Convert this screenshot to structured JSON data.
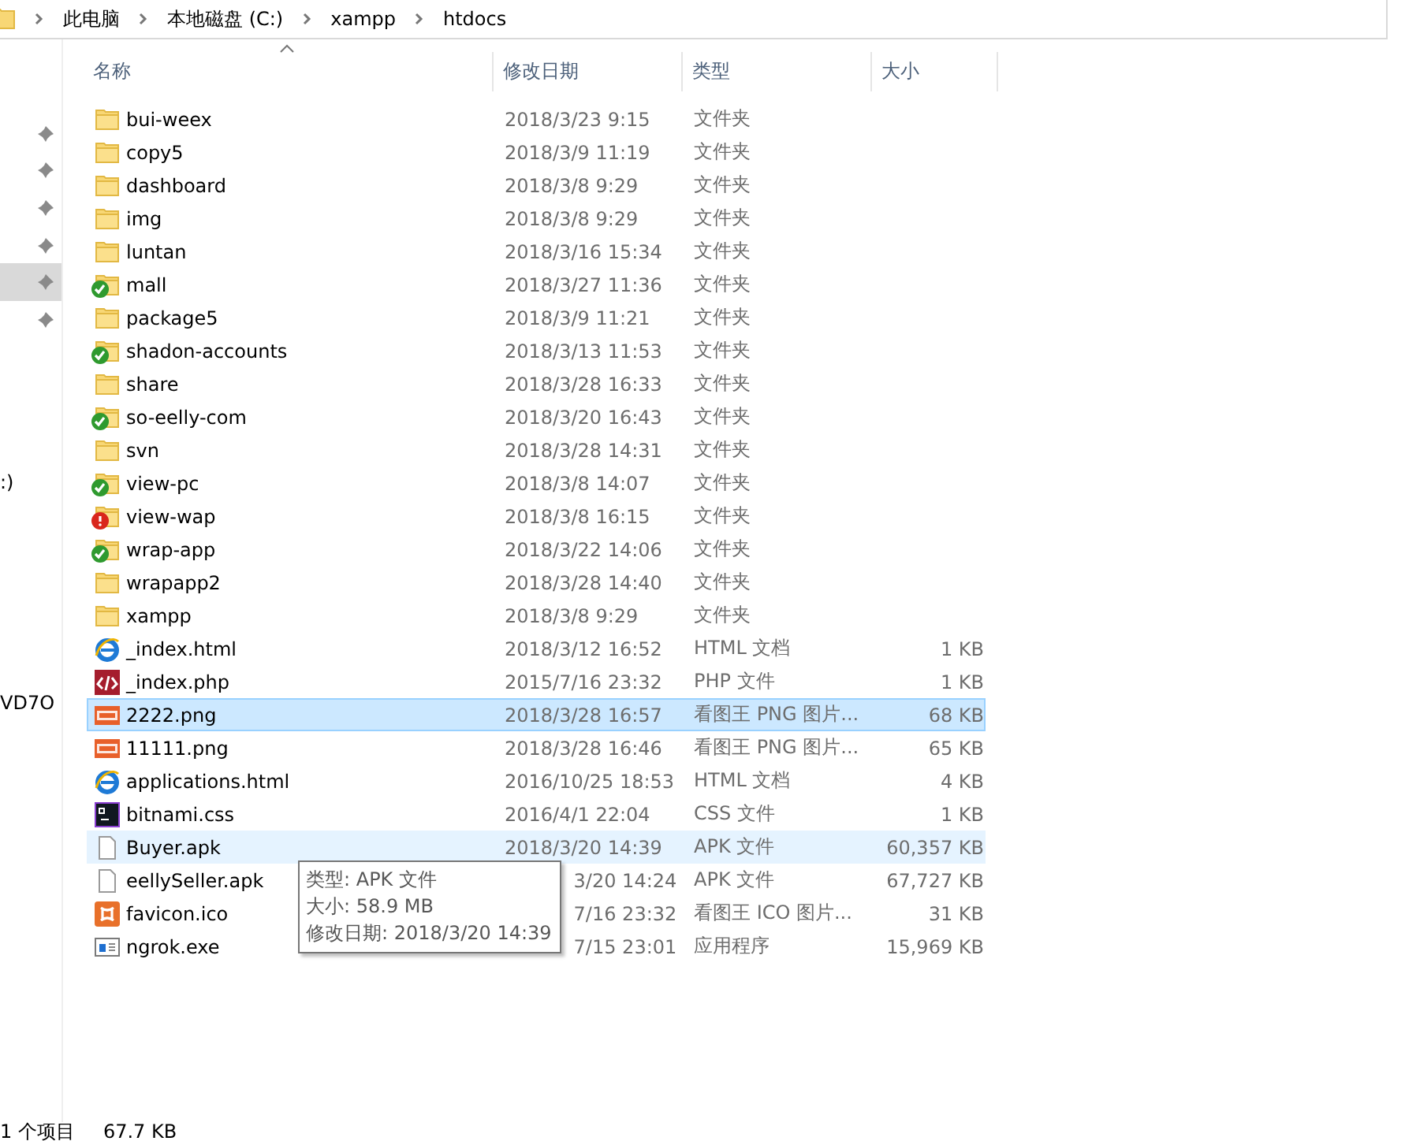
{
  "breadcrumb": [
    "此电脑",
    "本地磁盘 (C:)",
    "xampp",
    "htdocs"
  ],
  "nav_pane": {
    "pins": [
      {
        "selected": false
      },
      {
        "selected": false
      },
      {
        "selected": false
      },
      {
        "selected": false
      },
      {
        "selected": true
      },
      {
        "selected": false
      }
    ],
    "texts": [
      ":)",
      "VD7O"
    ]
  },
  "columns": [
    "名称",
    "修改日期",
    "类型",
    "大小"
  ],
  "rows": [
    {
      "name": "bui-weex",
      "date": "2018/3/23 9:15",
      "type": "文件夹",
      "kind": "folder",
      "selected": false,
      "hovered": false
    },
    {
      "name": "copy5",
      "date": "2018/3/9 11:19",
      "type": "文件夹",
      "kind": "folder",
      "selected": false,
      "hovered": false
    },
    {
      "name": "dashboard",
      "date": "2018/3/8 9:29",
      "type": "文件夹",
      "kind": "folder",
      "selected": false,
      "hovered": false
    },
    {
      "name": "img",
      "date": "2018/3/8 9:29",
      "type": "文件夹",
      "kind": "folder",
      "selected": false,
      "hovered": false
    },
    {
      "name": "luntan",
      "date": "2018/3/16 15:34",
      "type": "文件夹",
      "kind": "folder",
      "selected": false,
      "hovered": false
    },
    {
      "name": "mall",
      "date": "2018/3/27 11:36",
      "type": "文件夹",
      "kind": "folder",
      "badge": {
        "kind": "check",
        "color": "#2f9a2f"
      },
      "selected": false,
      "hovered": false
    },
    {
      "name": "package5",
      "date": "2018/3/9 11:21",
      "type": "文件夹",
      "kind": "folder",
      "selected": false,
      "hovered": false
    },
    {
      "name": "shadon-accounts",
      "date": "2018/3/13 11:53",
      "type": "文件夹",
      "kind": "folder",
      "badge": {
        "kind": "check",
        "color": "#2f9a2f"
      },
      "selected": false,
      "hovered": false
    },
    {
      "name": "share",
      "date": "2018/3/28 16:33",
      "type": "文件夹",
      "kind": "folder",
      "selected": false,
      "hovered": false
    },
    {
      "name": "so-eelly-com",
      "date": "2018/3/20 16:43",
      "type": "文件夹",
      "kind": "folder",
      "badge": {
        "kind": "check",
        "color": "#2f9a2f"
      },
      "selected": false,
      "hovered": false
    },
    {
      "name": "svn",
      "date": "2018/3/28 14:31",
      "type": "文件夹",
      "kind": "folder",
      "selected": false,
      "hovered": false
    },
    {
      "name": "view-pc",
      "date": "2018/3/8 14:07",
      "type": "文件夹",
      "kind": "folder",
      "badge": {
        "kind": "check",
        "color": "#2f9a2f"
      },
      "selected": false,
      "hovered": false
    },
    {
      "name": "view-wap",
      "date": "2018/3/8 16:15",
      "type": "文件夹",
      "kind": "folder",
      "badge": {
        "kind": "alert",
        "color": "#d9261c"
      },
      "selected": false,
      "hovered": false
    },
    {
      "name": "wrap-app",
      "date": "2018/3/22 14:06",
      "type": "文件夹",
      "kind": "folder",
      "badge": {
        "kind": "check",
        "color": "#2f9a2f"
      },
      "selected": false,
      "hovered": false
    },
    {
      "name": "wrapapp2",
      "date": "2018/3/28 14:40",
      "type": "文件夹",
      "kind": "folder",
      "selected": false,
      "hovered": false
    },
    {
      "name": "xampp",
      "date": "2018/3/8 9:29",
      "type": "文件夹",
      "kind": "folder",
      "selected": false,
      "hovered": false
    },
    {
      "name": "_index.html",
      "date": "2018/3/12 16:52",
      "type": "HTML 文档",
      "size": "1 KB",
      "kind": "html",
      "selected": false,
      "hovered": false
    },
    {
      "name": "_index.php",
      "date": "2015/7/16 23:32",
      "type": "PHP 文件",
      "size": "1 KB",
      "kind": "php",
      "selected": false,
      "hovered": false
    },
    {
      "name": "2222.png",
      "date": "2018/3/28 16:57",
      "type": "看图王 PNG 图片...",
      "size": "68 KB",
      "kind": "png",
      "selected": true,
      "hovered": false
    },
    {
      "name": "11111.png",
      "date": "2018/3/28 16:46",
      "type": "看图王 PNG 图片...",
      "size": "65 KB",
      "kind": "png",
      "selected": false,
      "hovered": false
    },
    {
      "name": "applications.html",
      "date": "2016/10/25 18:53",
      "type": "HTML 文档",
      "size": "4 KB",
      "kind": "html",
      "selected": false,
      "hovered": false
    },
    {
      "name": "bitnami.css",
      "date": "2016/4/1 22:04",
      "type": "CSS 文件",
      "size": "1 KB",
      "kind": "css",
      "selected": false,
      "hovered": false
    },
    {
      "name": "Buyer.apk",
      "date": "2018/3/20 14:39",
      "type": "APK 文件",
      "size": "60,357 KB",
      "kind": "apk",
      "selected": false,
      "hovered": true
    },
    {
      "name": "eellySeller.apk",
      "date": "3/20 14:24",
      "type": "APK 文件",
      "size": "67,727 KB",
      "kind": "apk",
      "selected": false,
      "hovered": false
    },
    {
      "name": "favicon.ico",
      "date": "7/16 23:32",
      "type": "看图王 ICO 图片...",
      "size": "31 KB",
      "kind": "ico",
      "selected": false,
      "hovered": false
    },
    {
      "name": "ngrok.exe",
      "date": "7/15 23:01",
      "type": "应用程序",
      "size": "15,969 KB",
      "kind": "exe",
      "selected": false,
      "hovered": false
    }
  ],
  "tooltip": [
    "类型: APK 文件",
    "大小: 58.9 MB",
    "修改日期: 2018/3/20 14:39"
  ],
  "status_bar": {
    "count": "1 个项目",
    "size": "67.7 KB"
  }
}
